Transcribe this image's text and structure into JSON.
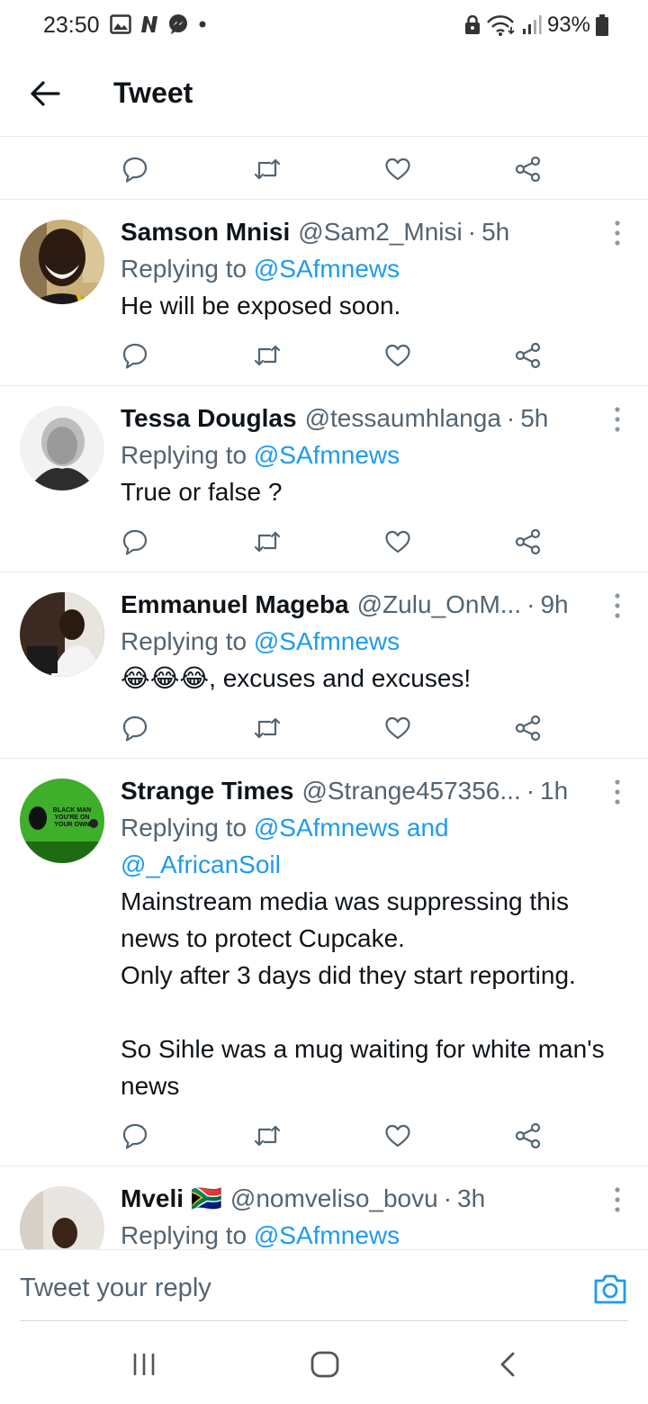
{
  "status_bar": {
    "time": "23:50",
    "battery": "93%",
    "left_icons": [
      "gallery-icon",
      "n-app-icon",
      "messenger-icon",
      "dot-icon"
    ],
    "right_icons": [
      "lock-icon",
      "wifi-icon",
      "signal-icon",
      "battery-icon"
    ]
  },
  "header": {
    "title": "Tweet",
    "back_icon": "arrow-left-icon"
  },
  "actions": [
    "reply-icon",
    "retweet-icon",
    "like-icon",
    "share-icon"
  ],
  "tweets": [
    {
      "name": "Samson Mnisi",
      "handle": "@Sam2_Mnisi",
      "sep": "·",
      "time": "5h",
      "replying_prefix": "Replying to ",
      "replying_mention": "@SAfmnews",
      "text": "He will be exposed soon."
    },
    {
      "name": "Tessa Douglas",
      "handle": "@tessaumhlanga",
      "sep": "·",
      "time": "5h",
      "replying_prefix": "Replying to ",
      "replying_mention": "@SAfmnews",
      "text": "True or false ?"
    },
    {
      "name": "Emmanuel Mageba",
      "handle": "@Zulu_OnM...",
      "sep": "·",
      "time": "9h",
      "replying_prefix": "Replying to ",
      "replying_mention": "@SAfmnews",
      "emoji": "😂😂😂",
      "text": ", excuses and excuses!"
    },
    {
      "name": "Strange Times",
      "handle": "@Strange457356...",
      "sep": "·",
      "time": "1h",
      "replying_prefix": "Replying to ",
      "replying_mention": "@SAfmnews and\n@_AfricanSoil",
      "avatar_text": "BLACK MAN YOU'RE ON YOUR OWN",
      "text": "Mainstream media was suppressing this news to protect Cupcake.\nOnly after 3 days did they start reporting.\n\nSo Sihle was a mug waiting for white man's news"
    },
    {
      "name": "Mveli",
      "flag": "🇿🇦",
      "handle": "@nomveliso_bovu",
      "sep": "·",
      "time": "3h",
      "replying_prefix": "Replying to ",
      "replying_mention": "@SAfmnews"
    }
  ],
  "composer": {
    "placeholder": "Tweet your reply",
    "icon": "camera-icon"
  },
  "nav": [
    "recents-icon",
    "home-icon",
    "back-icon"
  ],
  "colors": {
    "accent": "#1d9bf0",
    "secondary_text": "#536471",
    "divider": "#e6ecf0"
  }
}
